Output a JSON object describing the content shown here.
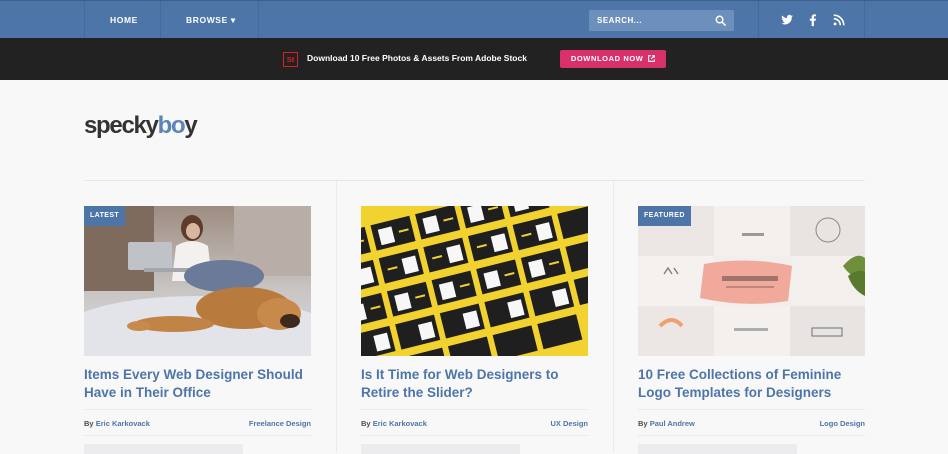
{
  "nav": {
    "home": "HOME",
    "browse": "BROWSE",
    "browse_caret": "▾",
    "search_placeholder": "SEARCH...",
    "social": [
      "twitter-icon",
      "facebook-icon",
      "rss-icon"
    ]
  },
  "promo": {
    "badge": "St",
    "text": "Download 10 Free Photos & Assets From Adobe Stock",
    "button": "DOWNLOAD NOW"
  },
  "logo": {
    "part1": "specky",
    "part2": "b",
    "part3": "o",
    "part4": "y"
  },
  "articles": [
    {
      "badge": "LATEST",
      "title": "Items Every Web Designer Should Have in Their Office",
      "author": "Eric Karkovack",
      "author_prefix": "By",
      "category": "Freelance Design"
    },
    {
      "badge": "",
      "title": "Is It Time for Web Designers to Retire the Slider?",
      "author": "Eric Karkovack",
      "author_prefix": "By",
      "category": "UX Design"
    },
    {
      "badge": "FEATURED",
      "title": "10 Free Collections of Feminine Logo Templates for Designers",
      "author": "Paul Andrew",
      "author_prefix": "By",
      "category": "Logo Design"
    }
  ],
  "colors": {
    "nav": "#4e75a8",
    "promo_bg": "#222222",
    "promo_button": "#d8306b",
    "accent": "#4e75a8"
  }
}
